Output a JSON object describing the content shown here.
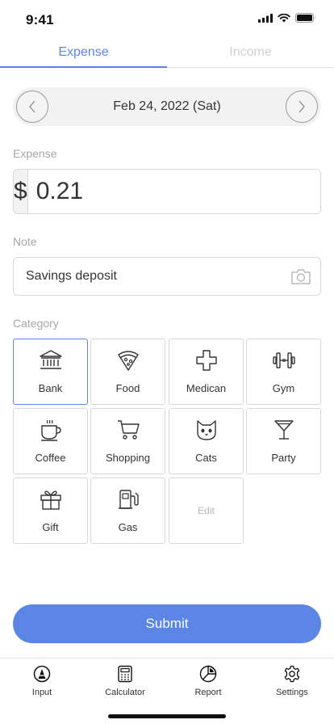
{
  "status": {
    "time": "9:41"
  },
  "tabs": [
    {
      "label": "Expense",
      "active": true
    },
    {
      "label": "Income",
      "active": false
    }
  ],
  "date_nav": {
    "date": "Feb 24, 2022 (Sat)",
    "prev_icon": "chevron-left-icon",
    "next_icon": "chevron-right-icon"
  },
  "amount": {
    "label": "Expense",
    "currency": "$",
    "value": "0.21"
  },
  "note": {
    "label": "Note",
    "value": "Savings deposit",
    "icon": "camera-icon"
  },
  "category": {
    "label": "Category",
    "items": [
      {
        "label": "Bank",
        "icon": "bank-icon",
        "selected": true
      },
      {
        "label": "Food",
        "icon": "pizza-icon"
      },
      {
        "label": "Medican",
        "icon": "medical-cross-icon"
      },
      {
        "label": "Gym",
        "icon": "dumbbell-icon"
      },
      {
        "label": "Coffee",
        "icon": "coffee-cup-icon"
      },
      {
        "label": "Shopping",
        "icon": "shopping-cart-icon"
      },
      {
        "label": "Cats",
        "icon": "cat-icon"
      },
      {
        "label": "Party",
        "icon": "cocktail-icon"
      },
      {
        "label": "Gift",
        "icon": "gift-icon"
      },
      {
        "label": "Gas",
        "icon": "gas-pump-icon"
      }
    ],
    "edit_label": "Edit"
  },
  "submit_label": "Submit",
  "bottom_nav": [
    {
      "label": "Input",
      "icon": "input-icon",
      "active": true
    },
    {
      "label": "Calculator",
      "icon": "calculator-icon"
    },
    {
      "label": "Report",
      "icon": "pie-chart-icon"
    },
    {
      "label": "Settings",
      "icon": "gear-icon"
    }
  ],
  "colors": {
    "accent": "#5b86e5",
    "border": "#d8d8d8",
    "muted": "#a6a6a6",
    "date_bar": "#f2f2f2"
  }
}
